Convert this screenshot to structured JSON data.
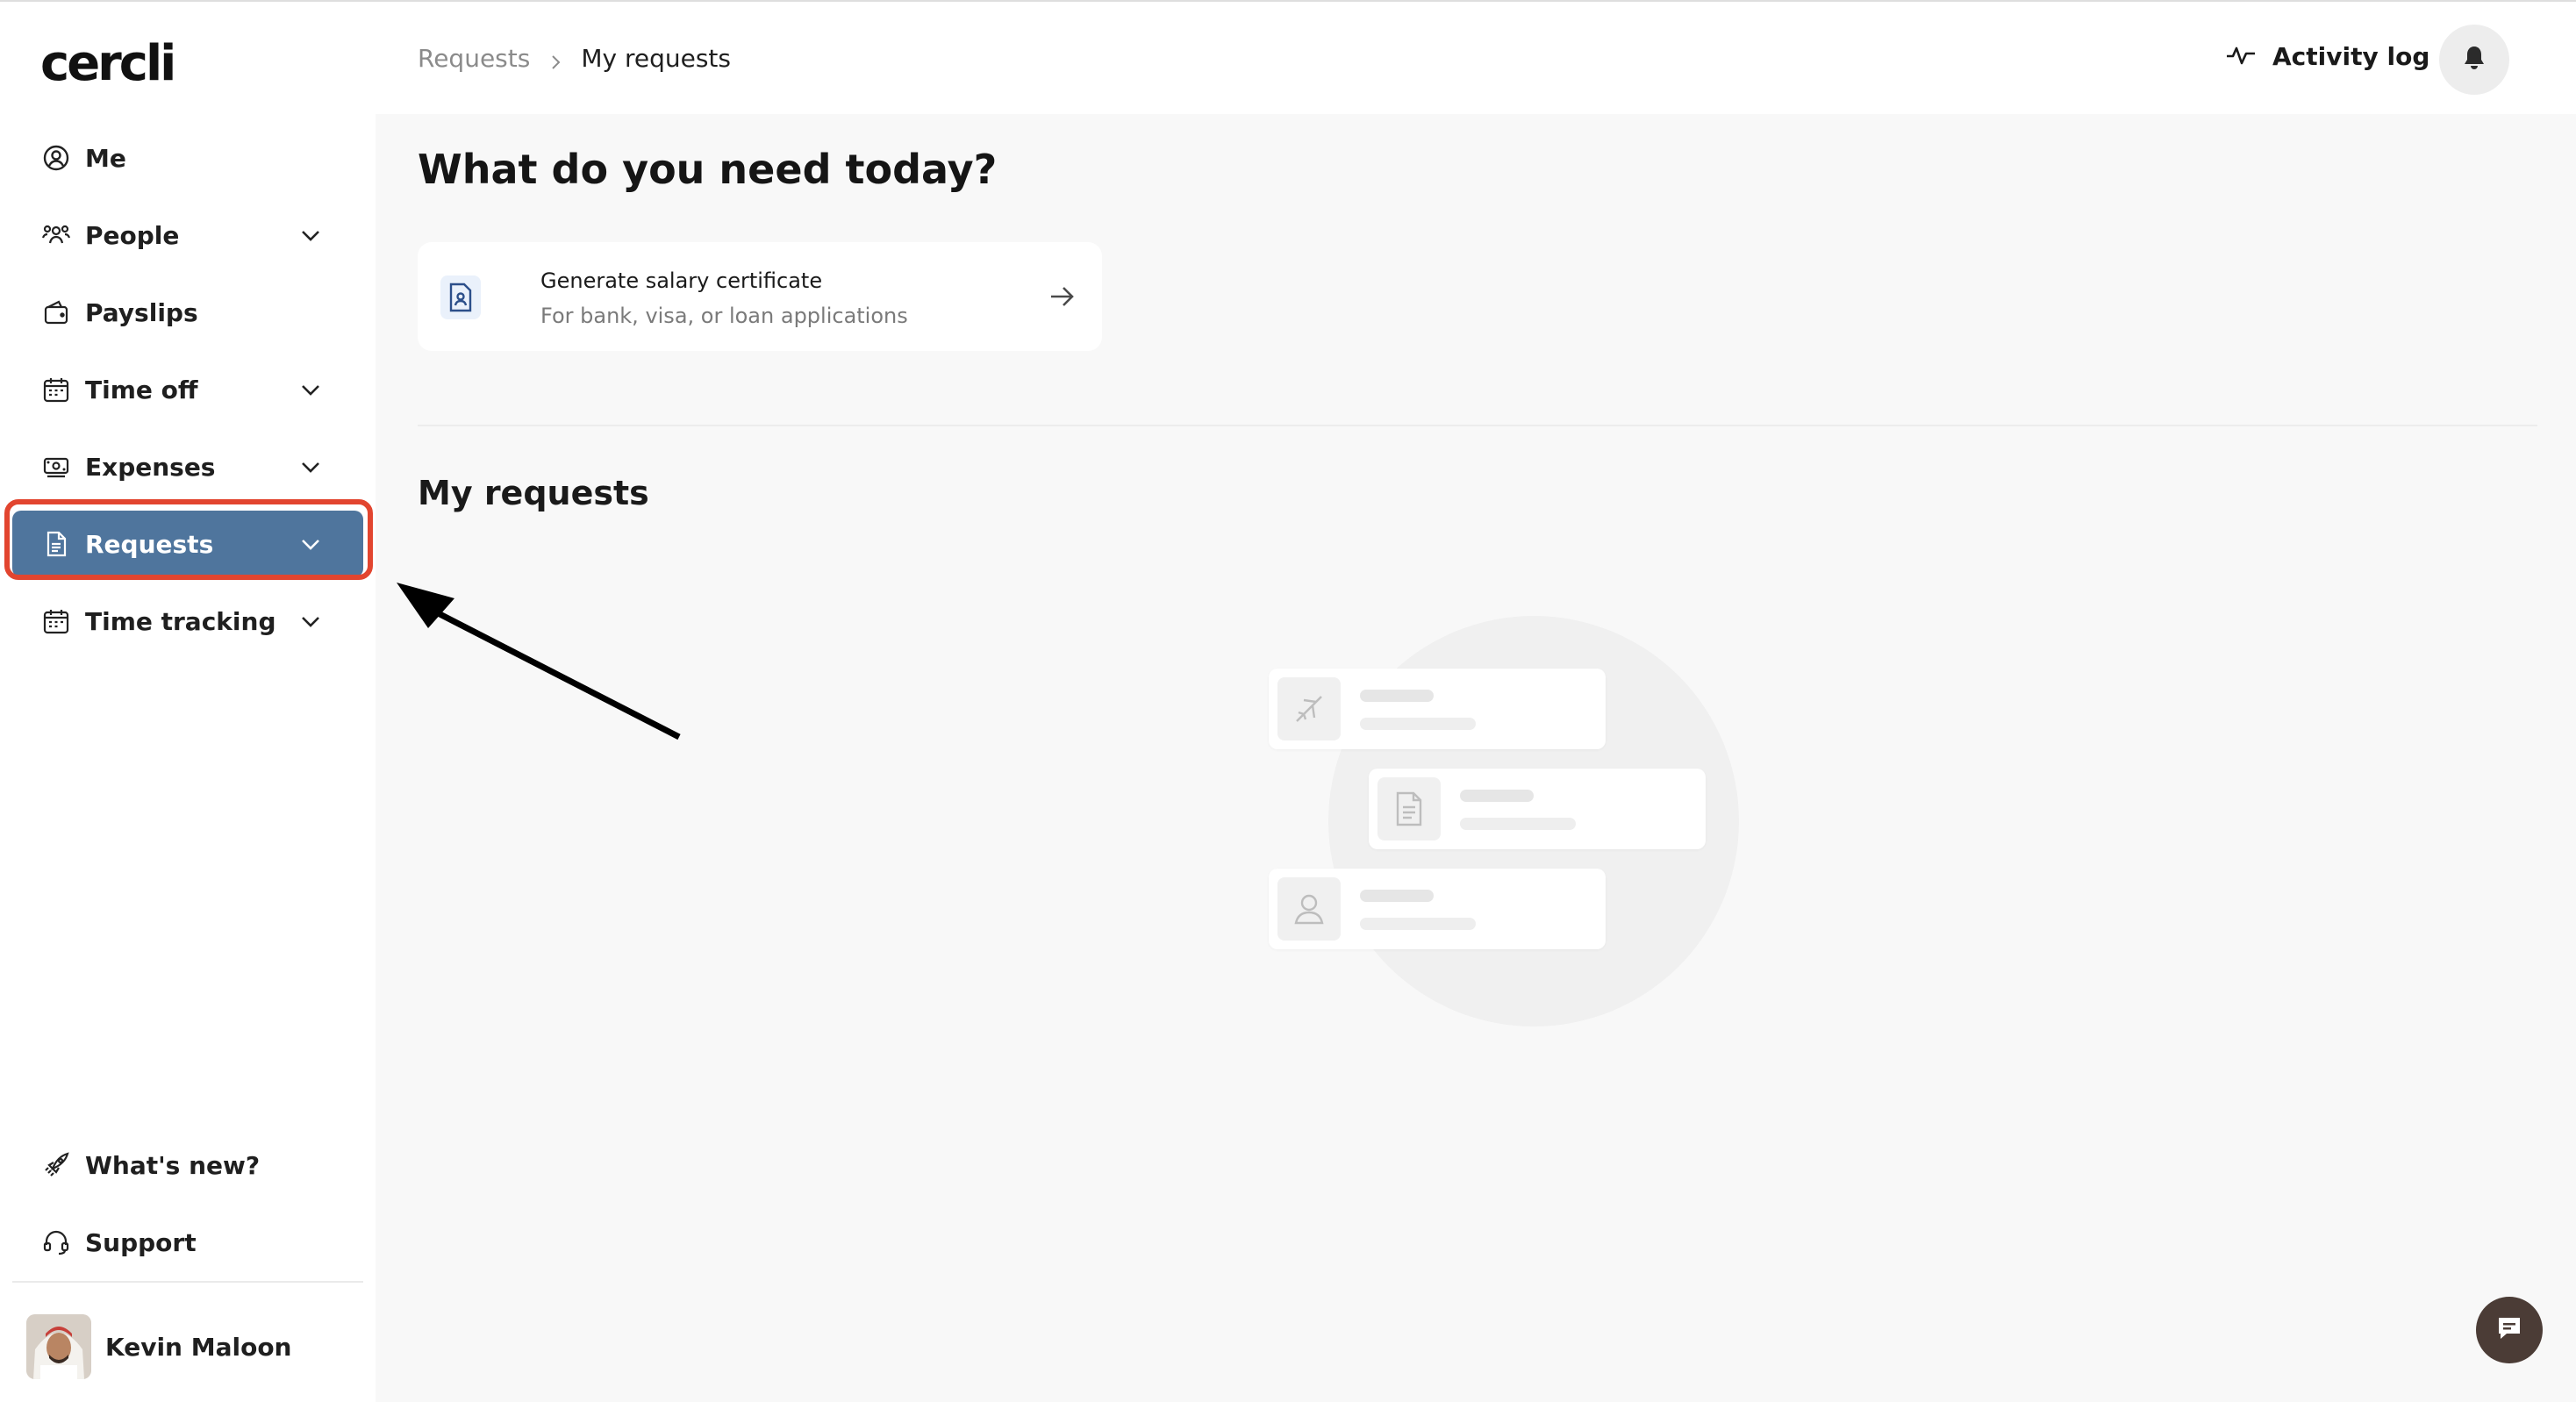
{
  "app": {
    "logo_text": "cercli"
  },
  "sidebar": {
    "items": [
      {
        "label": "Me",
        "icon": "user-circle-icon"
      },
      {
        "label": "People",
        "icon": "people-icon",
        "expandable": true
      },
      {
        "label": "Payslips",
        "icon": "wallet-icon"
      },
      {
        "label": "Time off",
        "icon": "calendar-icon",
        "expandable": true
      },
      {
        "label": "Expenses",
        "icon": "money-icon",
        "expandable": true
      },
      {
        "label": "Requests",
        "icon": "document-icon",
        "expandable": true,
        "active": true
      },
      {
        "label": "Time tracking",
        "icon": "calendar-icon",
        "expandable": true
      }
    ],
    "footer_items": [
      {
        "label": "What's new?",
        "icon": "rocket-icon"
      },
      {
        "label": "Support",
        "icon": "headset-icon"
      }
    ],
    "user": {
      "name": "Kevin Maloon"
    }
  },
  "header": {
    "breadcrumb": [
      "Requests",
      "My requests"
    ],
    "activity_log": "Activity log"
  },
  "main": {
    "title": "What do you need today?",
    "quick_action": {
      "title": "Generate salary certificate",
      "subtitle": "For bank, visa, or loan applications"
    },
    "section_title": "My requests"
  },
  "colors": {
    "active_nav": "#4f759d",
    "highlight": "#e2452f",
    "chat_button": "#4b3c36"
  }
}
